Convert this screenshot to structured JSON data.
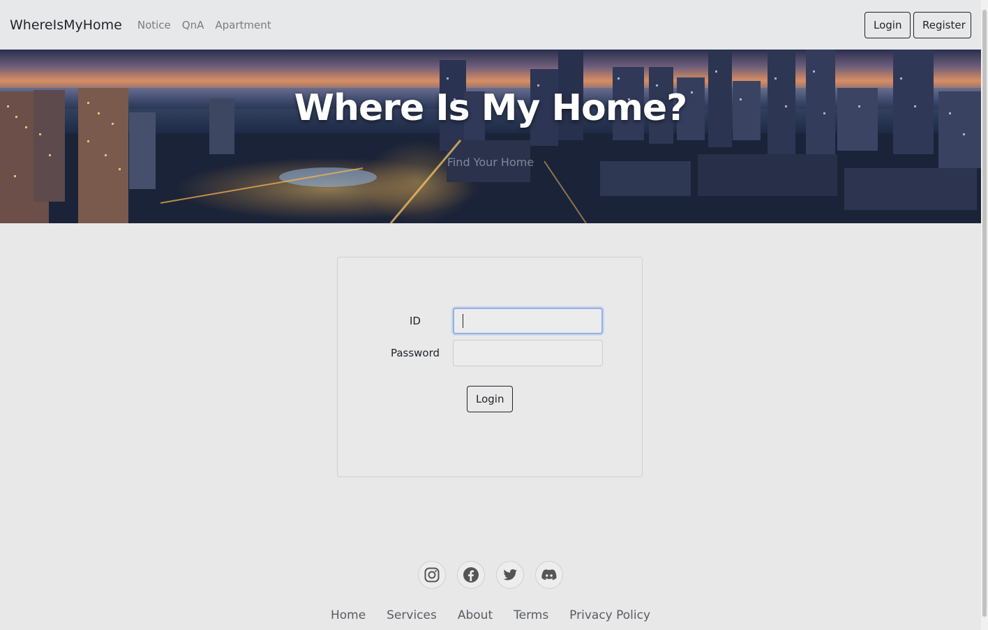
{
  "navbar": {
    "brand": "WhereIsMyHome",
    "links": [
      "Notice",
      "QnA",
      "Apartment"
    ],
    "login_label": "Login",
    "register_label": "Register"
  },
  "hero": {
    "title": "Where Is My Home?",
    "subtitle": "Find Your Home"
  },
  "login_form": {
    "id_label": "ID",
    "id_value": "",
    "password_label": "Password",
    "password_value": "",
    "submit_label": "Login"
  },
  "footer": {
    "social_icons": [
      "instagram-icon",
      "facebook-icon",
      "twitter-icon",
      "discord-icon"
    ],
    "links": [
      "Home",
      "Services",
      "About",
      "Terms",
      "Privacy Policy"
    ]
  }
}
